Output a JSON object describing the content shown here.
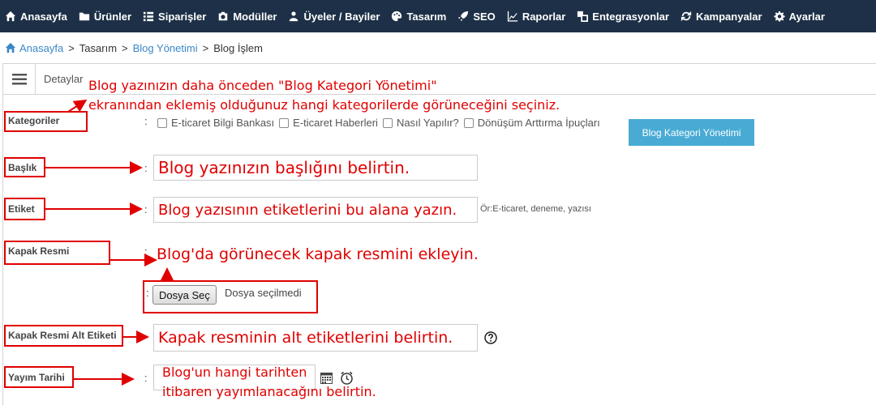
{
  "nav": {
    "items": [
      {
        "label": "Anasayfa",
        "icon": "home-icon"
      },
      {
        "label": "Ürünler",
        "icon": "folder-icon"
      },
      {
        "label": "Siparişler",
        "icon": "list-icon"
      },
      {
        "label": "Modüller",
        "icon": "module-icon"
      },
      {
        "label": "Üyeler / Bayiler",
        "icon": "users-icon"
      },
      {
        "label": "Tasarım",
        "icon": "palette-icon"
      },
      {
        "label": "SEO",
        "icon": "rocket-icon"
      },
      {
        "label": "Raporlar",
        "icon": "chart-icon"
      },
      {
        "label": "Entegrasyonlar",
        "icon": "integration-icon"
      },
      {
        "label": "Kampanyalar",
        "icon": "refresh-icon"
      },
      {
        "label": "Ayarlar",
        "icon": "gear-icon"
      }
    ]
  },
  "breadcrumb": {
    "home": "Anasayfa",
    "sep": ">",
    "items": [
      "Tasarım",
      "Blog Yönetimi",
      "Blog İşlem"
    ]
  },
  "panel": {
    "title": "Detaylar"
  },
  "form": {
    "colon": ":",
    "categories": {
      "label": "Kategoriler",
      "options": [
        "E-ticaret Bilgi Bankası",
        "E-ticaret Haberleri",
        "Nasıl Yapılır?",
        "Dönüşüm Arttırma İpuçları"
      ],
      "manage_button": "Blog Kategori Yönetimi"
    },
    "title_field": {
      "label": "Başlık",
      "value": "Blog yazınızın başlığını belirtin."
    },
    "tags_field": {
      "label": "Etiket",
      "value": "Blog yazısının etiketlerini bu alana yazın.",
      "hint": "Ör:E-ticaret, deneme, yazısı"
    },
    "cover_image": {
      "label": "Kapak Resmi",
      "file_button": "Dosya Seç",
      "file_status": "Dosya seçilmedi"
    },
    "cover_alt": {
      "label": "Kapak Resmi Alt Etiketi",
      "value": "Kapak resminin alt etiketlerini belirtin."
    },
    "publish_date": {
      "label": "Yayım Tarihi",
      "value_line1": "Blog'un hangi tarihten",
      "value_line2": "itibaren yayımlanacağını belirtin."
    }
  },
  "annotations": {
    "category_line1": "Blog yazınızın daha önceden \"Blog Kategori Yönetimi\"",
    "category_line2": "ekranından eklemiş olduğunuz hangi kategorilerde görüneceğini seçiniz.",
    "cover_image": "Blog'da görünecek kapak resmini ekleyin."
  },
  "colors": {
    "nav_bg": "#1d3047",
    "link": "#3a87c8",
    "annotation": "#e00000",
    "button": "#49abd4"
  }
}
